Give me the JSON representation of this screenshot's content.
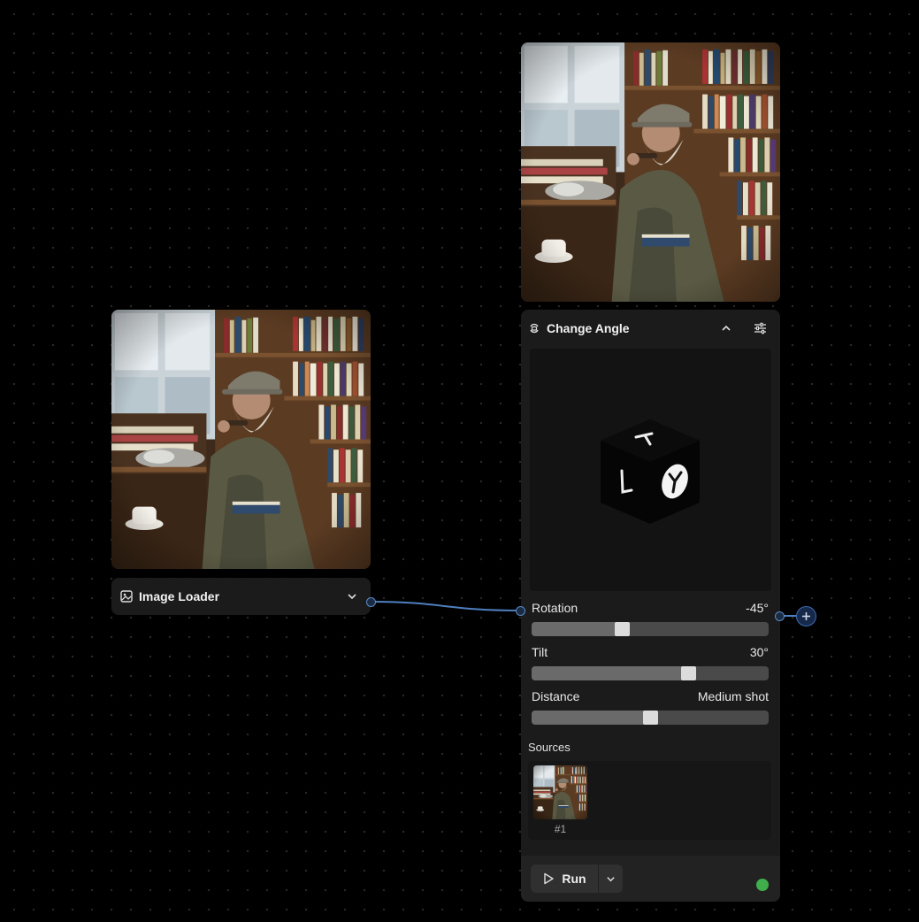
{
  "image_loader": {
    "title": "Image Loader",
    "icon": "image-icon",
    "dropdown_icon": "chevron-down-icon"
  },
  "change_angle": {
    "title": "Change Angle",
    "icon": "rotate-camera-icon",
    "collapse_icon": "chevron-up-icon",
    "settings_icon": "sliders-icon",
    "controls": [
      {
        "label": "Rotation",
        "value": "-45°",
        "level": 0.38
      },
      {
        "label": "Tilt",
        "value": "30°",
        "level": 0.66
      },
      {
        "label": "Distance",
        "value": "Medium shot",
        "level": 0.5
      }
    ],
    "sources_label": "Sources",
    "sources": [
      {
        "label": "#1"
      }
    ],
    "run_label": "Run",
    "status_color": "#3fae4b"
  },
  "colors": {
    "edge": "#4f7fbf",
    "node_bg": "#1b1b1b",
    "status_ok": "#3fae4b"
  }
}
